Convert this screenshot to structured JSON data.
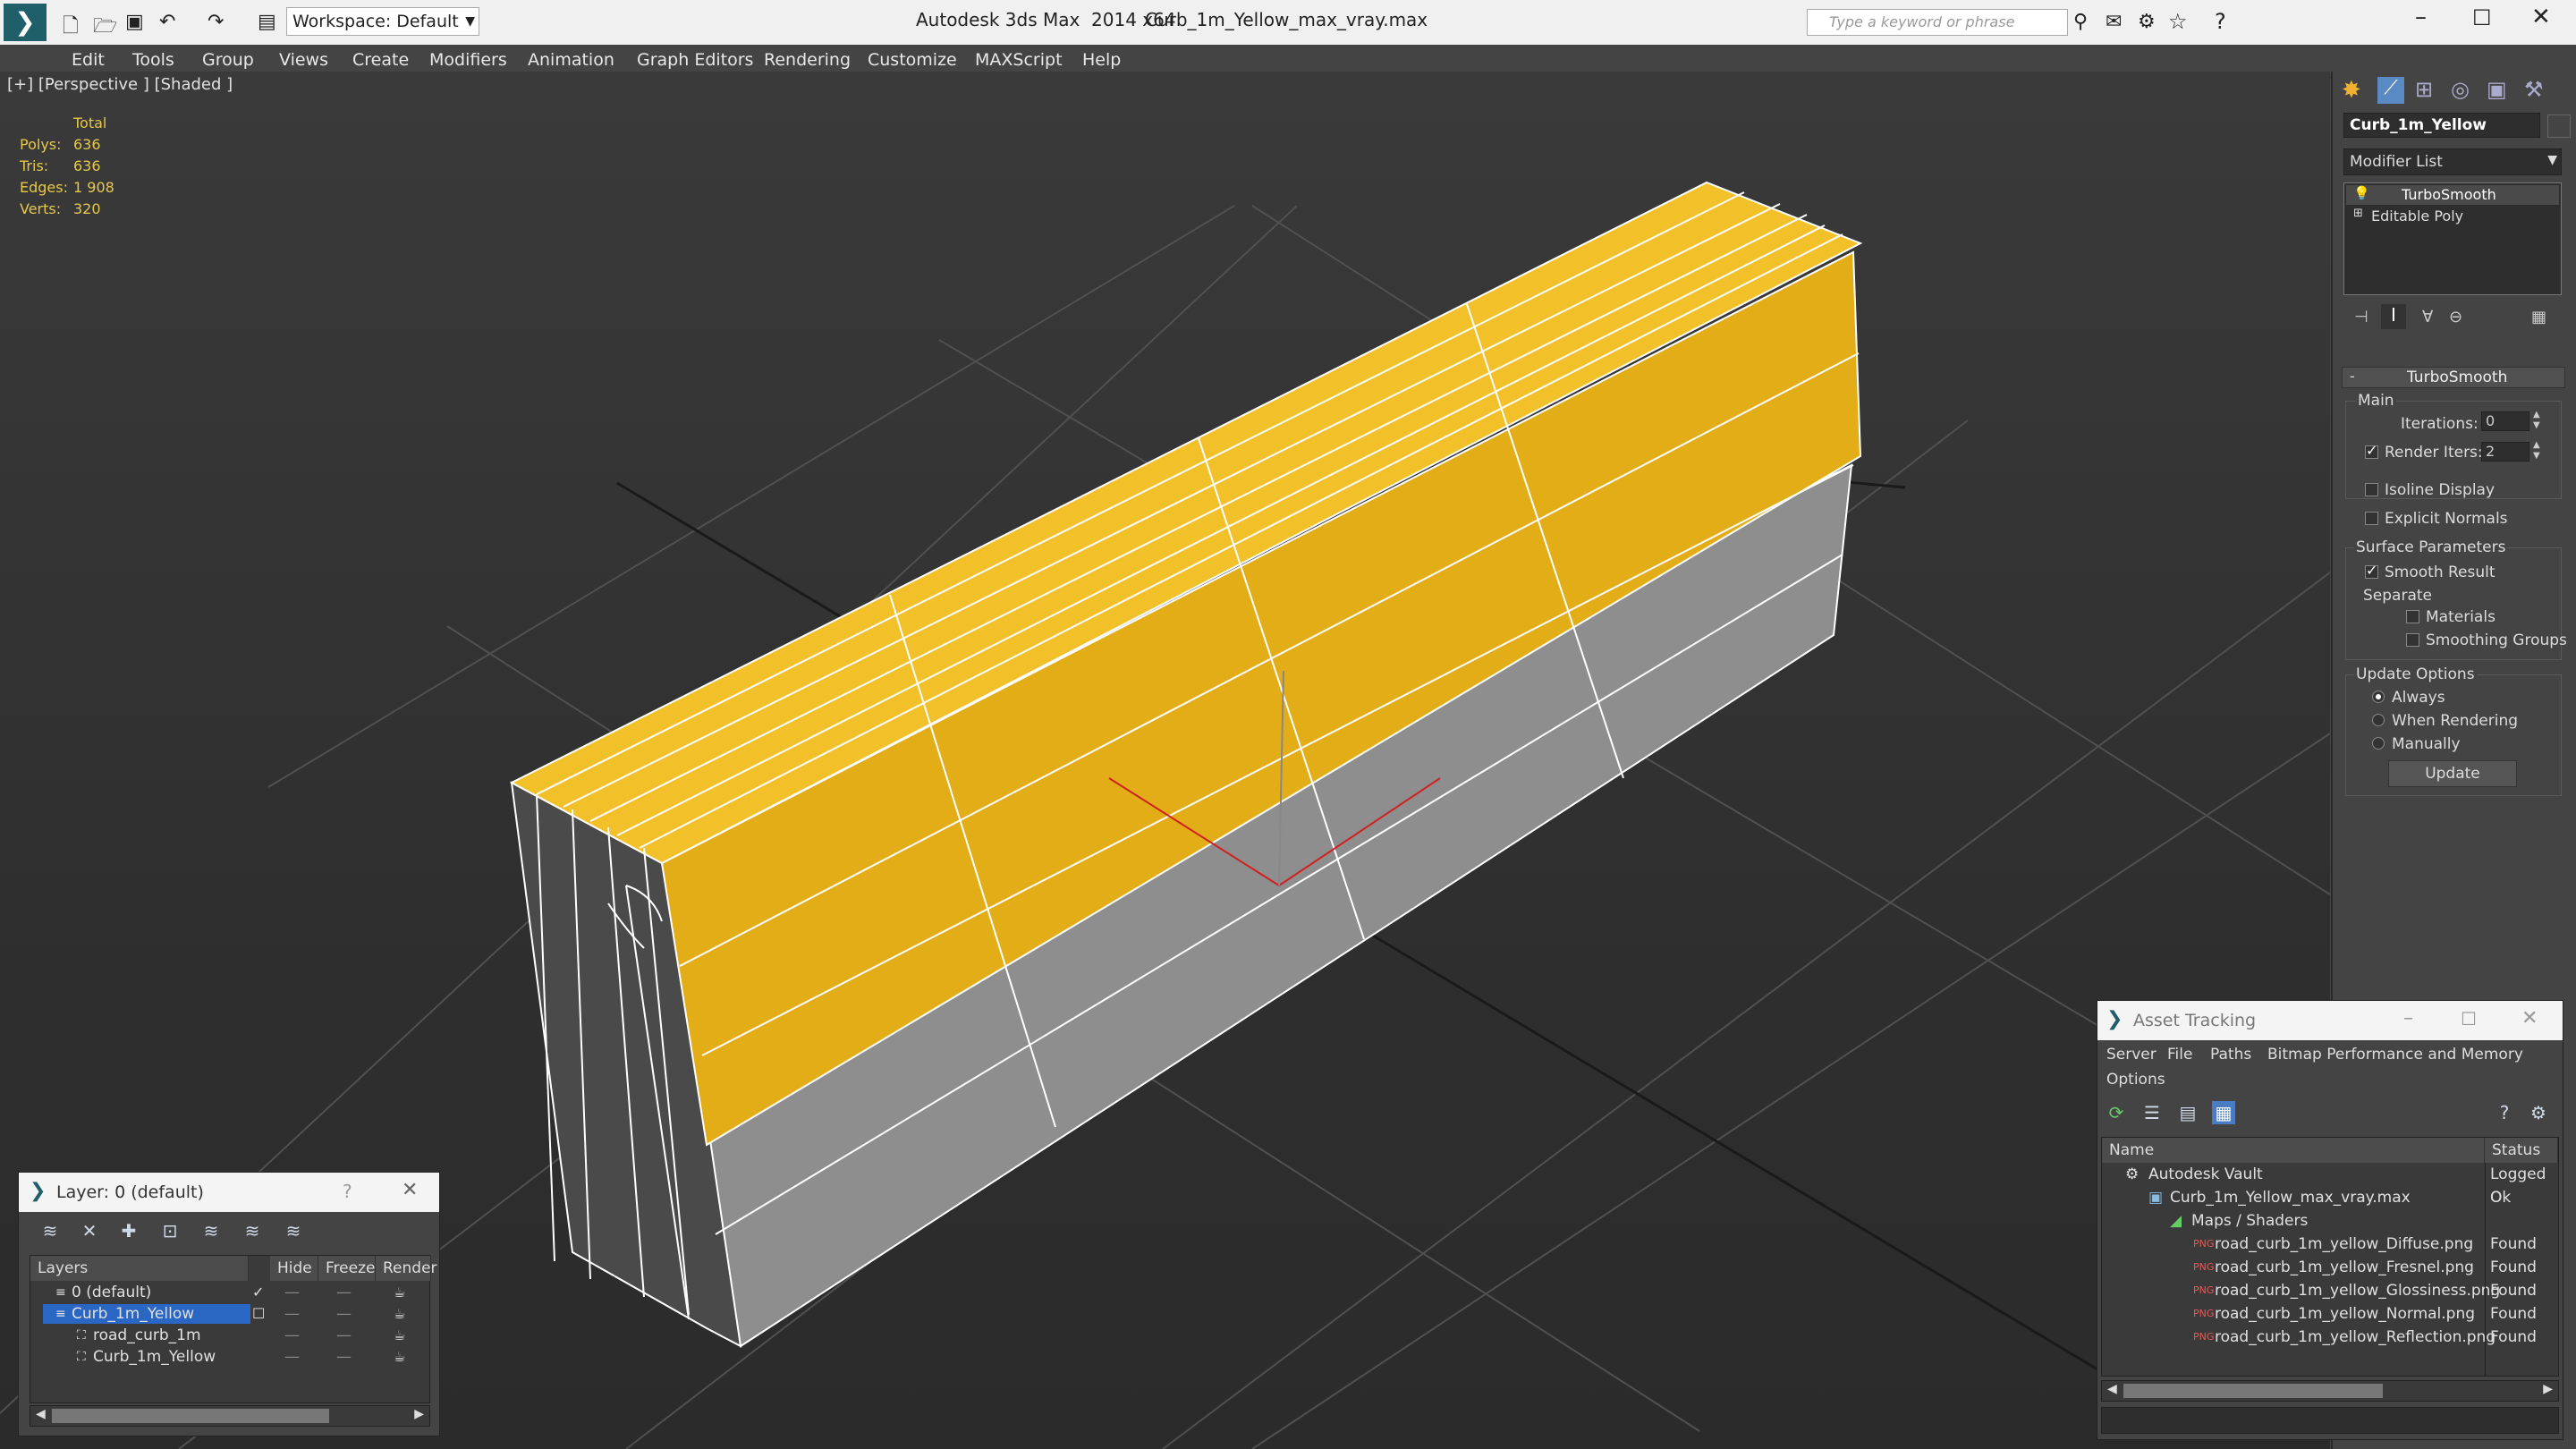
{
  "title_bar": {
    "workspace": "Workspace: Default",
    "app_title": "Autodesk 3ds Max  2014 x64",
    "file_name": "Curb_1m_Yellow_max_vray.max",
    "search_placeholder": "Type a keyword or phrase"
  },
  "menu": [
    "Edit",
    "Tools",
    "Group",
    "Views",
    "Create",
    "Modifiers",
    "Animation",
    "Graph Editors",
    "Rendering",
    "Customize",
    "MAXScript",
    "Help"
  ],
  "viewport": {
    "label": "[+] [Perspective ] [Shaded ]",
    "stats": {
      "header": "Total",
      "rows": [
        {
          "label": "Polys:",
          "value": "636"
        },
        {
          "label": "Tris:",
          "value": "636"
        },
        {
          "label": "Edges:",
          "value": "1 908"
        },
        {
          "label": "Verts:",
          "value": "320"
        }
      ]
    },
    "colors": {
      "top": "#e8b21a",
      "side": "#8a8a8a",
      "wire": "#ffffff"
    }
  },
  "command_panel": {
    "object_name": "Curb_1m_Yellow",
    "modifier_list": "Modifier List",
    "stack": [
      "TurboSmooth",
      "Editable Poly"
    ],
    "rollout_title": "TurboSmooth",
    "main_label": "Main",
    "iterations_label": "Iterations:",
    "iterations_value": "0",
    "render_iters_label": "Render Iters:",
    "render_iters_value": "2",
    "isoline": "Isoline Display",
    "explicit_normals": "Explicit Normals",
    "surface_params": "Surface Parameters",
    "smooth_result": "Smooth Result",
    "separate": "Separate",
    "materials": "Materials",
    "smoothing_groups": "Smoothing Groups",
    "update_options": "Update Options",
    "always": "Always",
    "when_rendering": "When Rendering",
    "manually": "Manually",
    "update_button": "Update"
  },
  "layer_window": {
    "title": "Layer: 0 (default)",
    "help": "?",
    "columns": [
      "Layers",
      "Hide",
      "Freeze",
      "Render"
    ],
    "rows": [
      "0 (default)",
      "Curb_1m_Yellow",
      "road_curb_1m",
      "Curb_1m_Yellow"
    ]
  },
  "asset_window": {
    "title": "Asset Tracking",
    "menu": [
      "Server",
      "File",
      "Paths",
      "Bitmap Performance and Memory"
    ],
    "menu2": "Options",
    "columns": [
      "Name",
      "Status"
    ],
    "rows": [
      {
        "name": "Autodesk Vault",
        "status": "Logged O"
      },
      {
        "name": "Curb_1m_Yellow_max_vray.max",
        "status": "Ok"
      },
      {
        "name": "Maps / Shaders",
        "status": ""
      },
      {
        "name": "road_curb_1m_yellow_Diffuse.png",
        "status": "Found"
      },
      {
        "name": "road_curb_1m_yellow_Fresnel.png",
        "status": "Found"
      },
      {
        "name": "road_curb_1m_yellow_Glossiness.png",
        "status": "Found"
      },
      {
        "name": "road_curb_1m_yellow_Normal.png",
        "status": "Found"
      },
      {
        "name": "road_curb_1m_yellow_Reflection.png",
        "status": "Found"
      }
    ]
  }
}
